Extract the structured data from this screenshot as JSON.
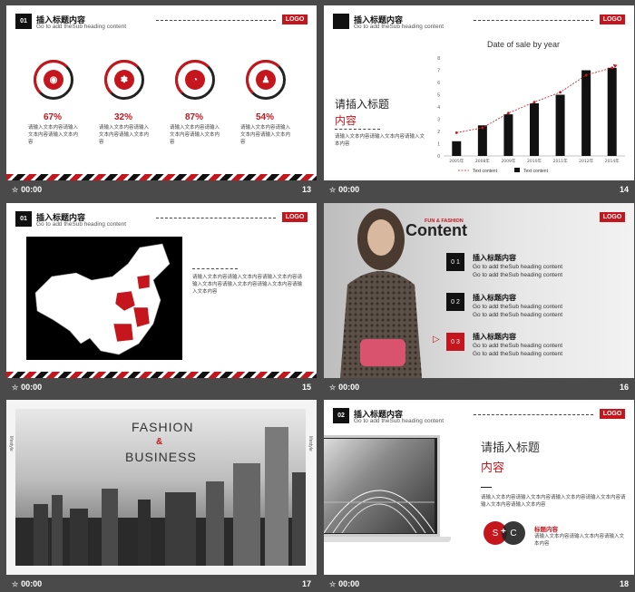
{
  "common": {
    "logo": "LOGO",
    "star": "☆",
    "time": "00:00",
    "header_title": "插入标题内容",
    "header_sub": "Go to add theSub heading content",
    "body_text": "请输入文本内容请输入文本内容请输入文本内容"
  },
  "s13": {
    "num": "13",
    "header_num": "01",
    "items": [
      {
        "pct": "67%",
        "icon": "weibo-icon"
      },
      {
        "pct": "32%",
        "icon": "baidu-paw-icon"
      },
      {
        "pct": "87%",
        "icon": "chat-icon"
      },
      {
        "pct": "54%",
        "icon": "qq-penguin-icon"
      }
    ],
    "item_text": "请输入文本内容请输入文本内容请输入文本内容"
  },
  "s14": {
    "num": "14",
    "title": "请插入标题",
    "title_red": "内容",
    "text": "请输入文本内容请输入文本内容请输入文本内容",
    "chart_data": {
      "type": "bar",
      "title": "Date of sale by year",
      "categories": [
        "2005年",
        "2008年",
        "2009年",
        "2010年",
        "2011年",
        "2012年",
        "2014年"
      ],
      "series": [
        {
          "name": "Text content",
          "type": "line",
          "values": [
            1.9,
            2.3,
            3.5,
            4.4,
            5.2,
            6.6,
            7.2
          ],
          "color": "#c4161c"
        },
        {
          "name": "Text content",
          "type": "bar",
          "values": [
            1.2,
            2.5,
            3.4,
            4.3,
            5.0,
            7.0,
            7.2
          ],
          "color": "#111"
        }
      ],
      "ylim": [
        0,
        8
      ],
      "yticks": [
        "0",
        "1",
        "2",
        "3",
        "4",
        "5",
        "6",
        "7",
        "8"
      ]
    }
  },
  "s15": {
    "num": "15",
    "header_num": "01",
    "text": "请输入文本内容请输入文本内容请输入文本内容请输入文本内容请输入文本内容请输入文本内容请输入文本内容"
  },
  "s16": {
    "num": "16",
    "tag_fun": "FUN & FASHION",
    "tag_title": "Content",
    "items": [
      {
        "n": "0 1",
        "title": "插入标题内容",
        "line1": "Go to add theSub heading content",
        "line2": "Go to add theSub heading content"
      },
      {
        "n": "0 2",
        "title": "插入标题内容",
        "line1": "Go to add theSub heading content",
        "line2": "Go to add theSub heading content"
      },
      {
        "n": "0 3",
        "title": "插入标题内容",
        "line1": "Go to add theSub heading content",
        "line2": "Go to add theSub heading content"
      }
    ]
  },
  "s17": {
    "num": "17",
    "word1": "FASHION",
    "amp": "&",
    "word2": "BUSINESS",
    "side_text": "lifestyle"
  },
  "s18": {
    "num": "18",
    "header_num": "02",
    "title": "请插入标题",
    "title_red": "内容",
    "text": "请输入文本内容请输入文本内容请输入文本内容请输入文本内容请输入文本内容请输入文本内容",
    "circle_s": "S",
    "circle_plus": "+",
    "circle_c": "C",
    "label": "标题内容",
    "label_text": "请输入文本内容请输入文本内容请输入文本内容"
  }
}
